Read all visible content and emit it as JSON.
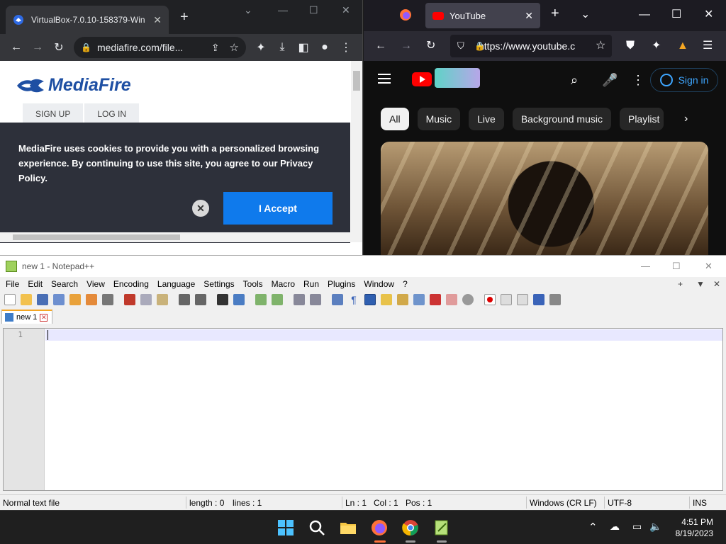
{
  "chrome": {
    "tab_title": "VirtualBox-7.0.10-158379-Win",
    "tab_close": "✕",
    "new_tab": "+",
    "url": "mediafire.com/file...",
    "page": {
      "logo_text": "MediaFire",
      "signup": "SIGN UP",
      "login": "LOG IN",
      "cookie_message": "MediaFire uses cookies to provide you with a personalized browsing experience. By continuing to use this site, you agree to our Privacy Policy.",
      "cookie_close": "✕",
      "accept_label": "I Accept"
    }
  },
  "firefox": {
    "tab_title": "YouTube",
    "tab_close": "✕",
    "new_tab": "+",
    "url": "https://www.youtube.c",
    "youtube": {
      "sign_in": "Sign in",
      "chips": [
        "All",
        "Music",
        "Live",
        "Background music",
        "Playlist"
      ]
    }
  },
  "notepad": {
    "title": "new 1 - Notepad++",
    "menu": [
      "File",
      "Edit",
      "Search",
      "View",
      "Encoding",
      "Language",
      "Settings",
      "Tools",
      "Macro",
      "Run",
      "Plugins",
      "Window",
      "?"
    ],
    "tab": "new 1",
    "line_number": "1",
    "status": {
      "file_type": "Normal text file",
      "length": "length : 0",
      "lines": "lines : 1",
      "ln": "Ln : 1",
      "col": "Col : 1",
      "pos": "Pos : 1",
      "eol": "Windows (CR LF)",
      "encoding": "UTF-8",
      "mode": "INS"
    }
  },
  "taskbar": {
    "time": "4:51 PM",
    "date": "8/19/2023"
  },
  "colors": {
    "mediafire_blue": "#1e4fa3",
    "accept_blue": "#0f7aec",
    "youtube_red": "#ff0000",
    "signin_blue": "#3ea6ff"
  }
}
